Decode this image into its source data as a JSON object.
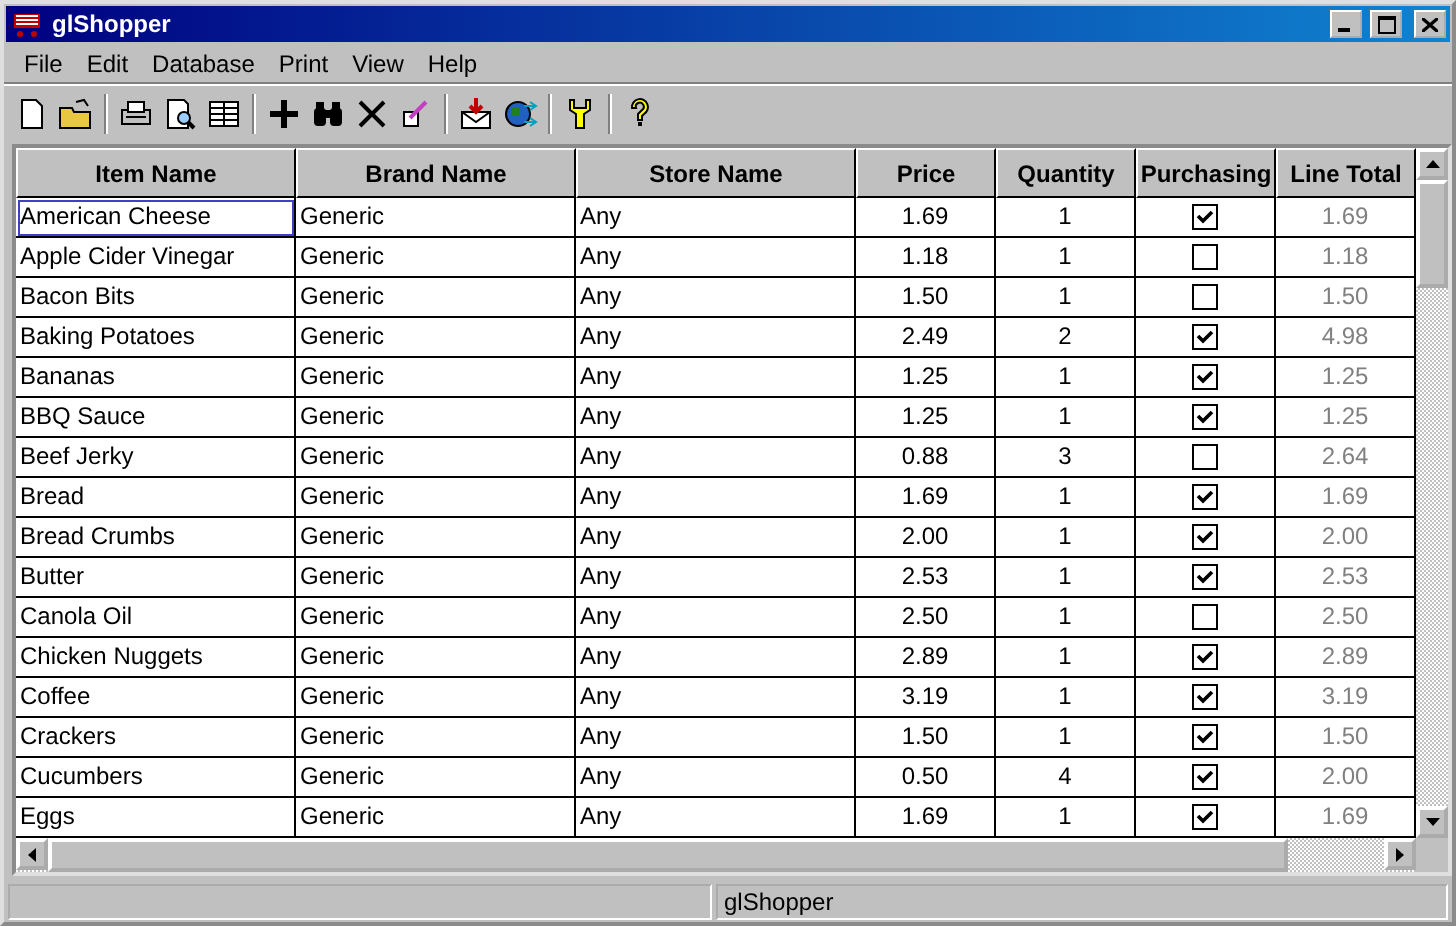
{
  "window": {
    "title": "glShopper"
  },
  "menu": [
    "File",
    "Edit",
    "Database",
    "Print",
    "View",
    "Help"
  ],
  "table": {
    "columns": [
      "Item Name",
      "Brand Name",
      "Store Name",
      "Price",
      "Quantity",
      "Purchasing",
      "Line Total"
    ],
    "rows": [
      {
        "item": "American Cheese",
        "brand": "Generic",
        "store": "Any",
        "price": "1.69",
        "quantity": "1",
        "purchasing": true,
        "total": "1.69",
        "focused": true
      },
      {
        "item": "Apple Cider Vinegar",
        "brand": "Generic",
        "store": "Any",
        "price": "1.18",
        "quantity": "1",
        "purchasing": false,
        "total": "1.18",
        "focused": false
      },
      {
        "item": "Bacon Bits",
        "brand": "Generic",
        "store": "Any",
        "price": "1.50",
        "quantity": "1",
        "purchasing": false,
        "total": "1.50",
        "focused": false
      },
      {
        "item": "Baking Potatoes",
        "brand": "Generic",
        "store": "Any",
        "price": "2.49",
        "quantity": "2",
        "purchasing": true,
        "total": "4.98",
        "focused": false
      },
      {
        "item": "Bananas",
        "brand": "Generic",
        "store": "Any",
        "price": "1.25",
        "quantity": "1",
        "purchasing": true,
        "total": "1.25",
        "focused": false
      },
      {
        "item": "BBQ Sauce",
        "brand": "Generic",
        "store": "Any",
        "price": "1.25",
        "quantity": "1",
        "purchasing": true,
        "total": "1.25",
        "focused": false
      },
      {
        "item": "Beef Jerky",
        "brand": "Generic",
        "store": "Any",
        "price": "0.88",
        "quantity": "3",
        "purchasing": false,
        "total": "2.64",
        "focused": false
      },
      {
        "item": "Bread",
        "brand": "Generic",
        "store": "Any",
        "price": "1.69",
        "quantity": "1",
        "purchasing": true,
        "total": "1.69",
        "focused": false
      },
      {
        "item": "Bread Crumbs",
        "brand": "Generic",
        "store": "Any",
        "price": "2.00",
        "quantity": "1",
        "purchasing": true,
        "total": "2.00",
        "focused": false
      },
      {
        "item": "Butter",
        "brand": "Generic",
        "store": "Any",
        "price": "2.53",
        "quantity": "1",
        "purchasing": true,
        "total": "2.53",
        "focused": false
      },
      {
        "item": "Canola Oil",
        "brand": "Generic",
        "store": "Any",
        "price": "2.50",
        "quantity": "1",
        "purchasing": false,
        "total": "2.50",
        "focused": false
      },
      {
        "item": "Chicken Nuggets",
        "brand": "Generic",
        "store": "Any",
        "price": "2.89",
        "quantity": "1",
        "purchasing": true,
        "total": "2.89",
        "focused": false
      },
      {
        "item": "Coffee",
        "brand": "Generic",
        "store": "Any",
        "price": "3.19",
        "quantity": "1",
        "purchasing": true,
        "total": "3.19",
        "focused": false
      },
      {
        "item": "Crackers",
        "brand": "Generic",
        "store": "Any",
        "price": "1.50",
        "quantity": "1",
        "purchasing": true,
        "total": "1.50",
        "focused": false
      },
      {
        "item": "Cucumbers",
        "brand": "Generic",
        "store": "Any",
        "price": "0.50",
        "quantity": "4",
        "purchasing": true,
        "total": "2.00",
        "focused": false
      },
      {
        "item": "Eggs",
        "brand": "Generic",
        "store": "Any",
        "price": "1.69",
        "quantity": "1",
        "purchasing": true,
        "total": "1.69",
        "focused": false
      }
    ]
  },
  "status_bar": {
    "text": "glShopper"
  }
}
